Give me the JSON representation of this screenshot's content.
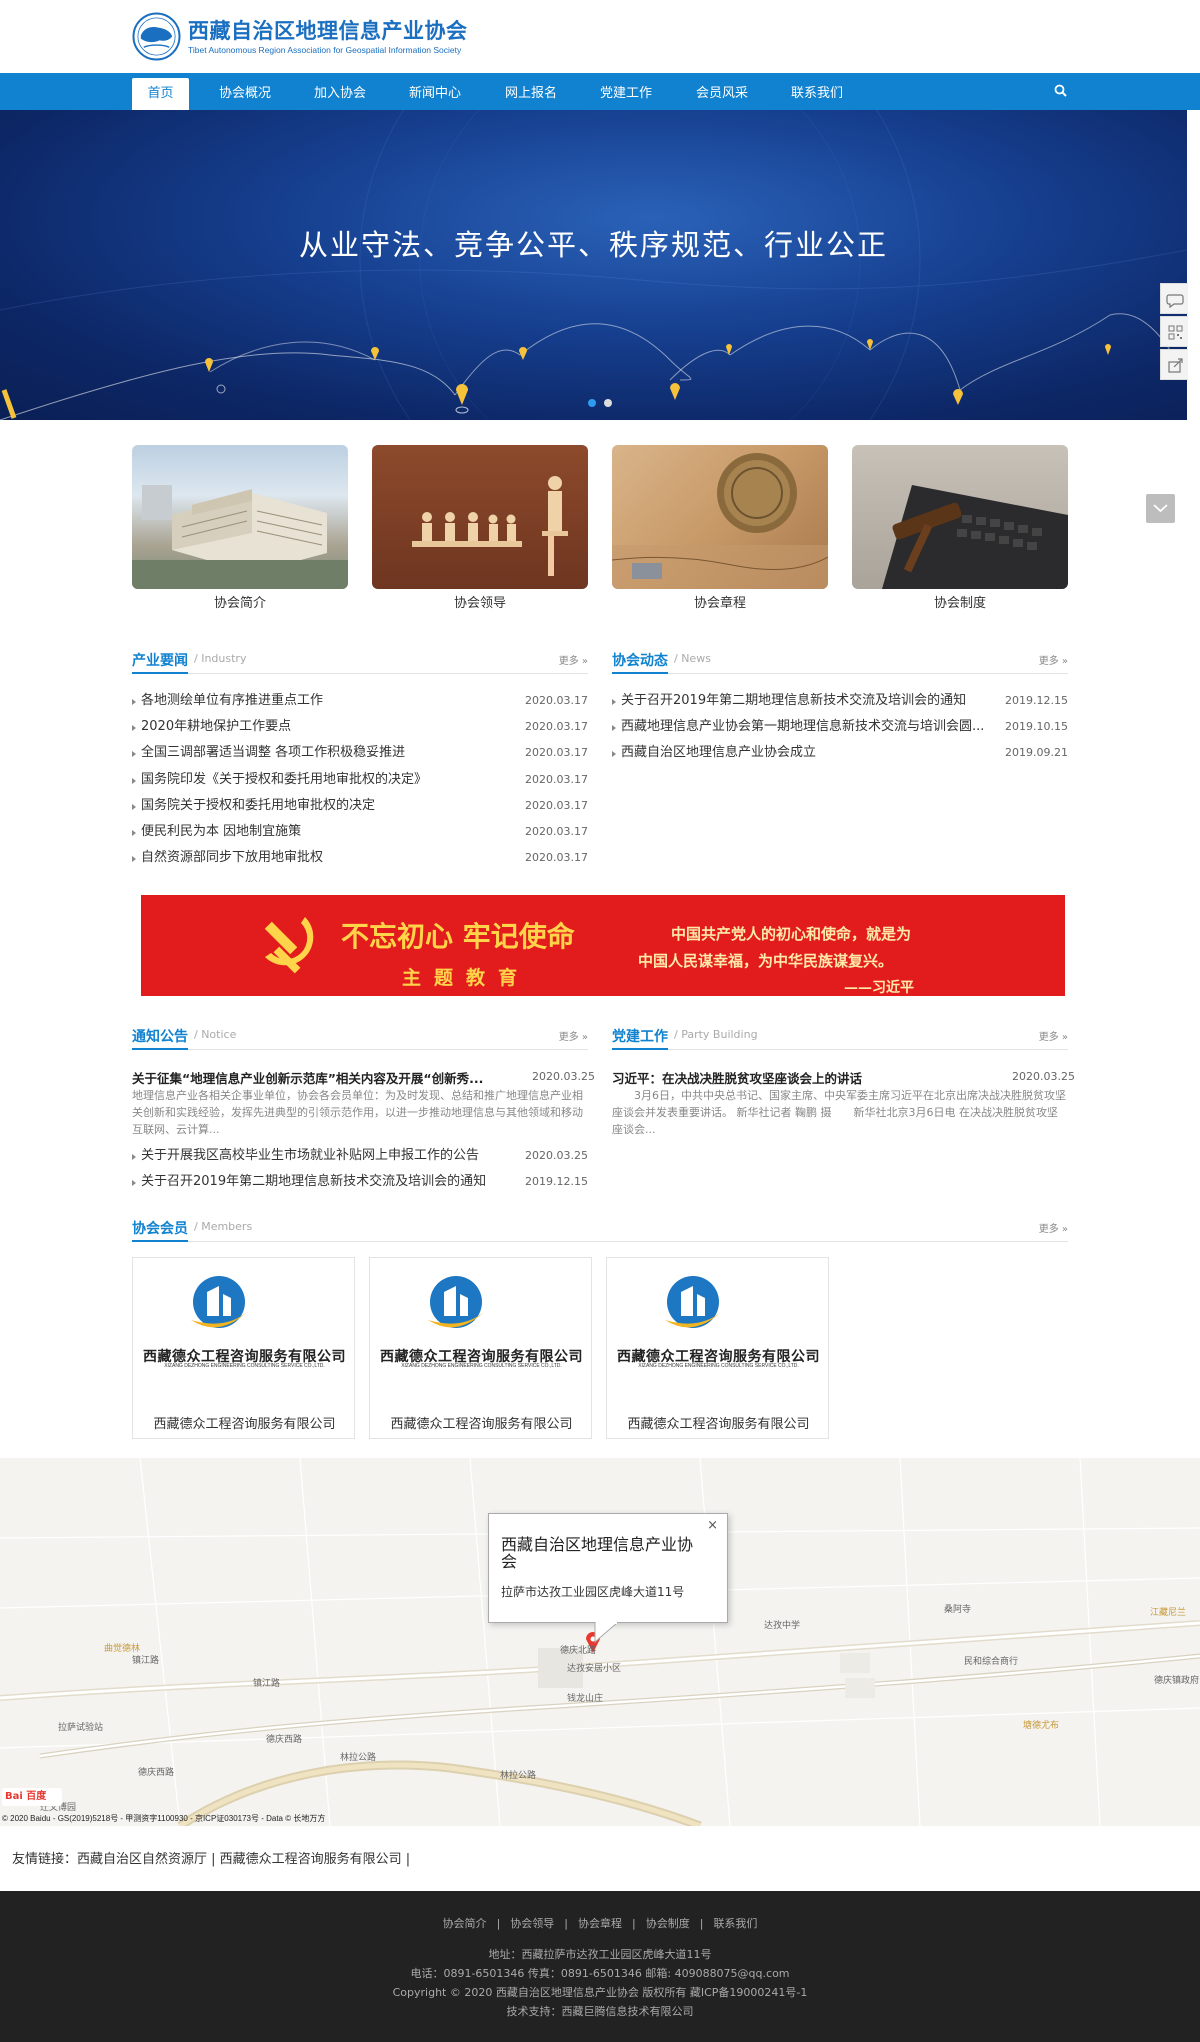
{
  "header": {
    "title": "西藏自治区地理信息产业协会",
    "subtitle": "Tibet Autonomous Region Association for Geospatial Information Society"
  },
  "nav": {
    "items": [
      "首页",
      "协会概况",
      "加入协会",
      "新闻中心",
      "网上报名",
      "党建工作",
      "会员风采",
      "联系我们"
    ],
    "active": "首页",
    "search_icon": "search-icon"
  },
  "banner": {
    "slogan": "从业守法、竞争公平、秩序规范、行业公正",
    "slides_total": 2,
    "active_slide": 1
  },
  "side_tools": [
    "chat-icon",
    "qrcode-icon",
    "share-icon"
  ],
  "features": [
    {
      "label": "协会简介"
    },
    {
      "label": "协会领导"
    },
    {
      "label": "协会章程"
    },
    {
      "label": "协会制度"
    }
  ],
  "industry": {
    "title": "产业要闻",
    "subtitle": "/ Industry",
    "more": "更多 »",
    "items": [
      {
        "title": "各地测绘单位有序推进重点工作",
        "date": "2020.03.17"
      },
      {
        "title": "2020年耕地保护工作要点",
        "date": "2020.03.17"
      },
      {
        "title": "全国三调部署适当调整 各项工作积极稳妥推进",
        "date": "2020.03.17"
      },
      {
        "title": "国务院印发《关于授权和委托用地审批权的决定》",
        "date": "2020.03.17"
      },
      {
        "title": "国务院关于授权和委托用地审批权的决定",
        "date": "2020.03.17"
      },
      {
        "title": "便民利民为本 因地制宜施策",
        "date": "2020.03.17"
      },
      {
        "title": "自然资源部同步下放用地审批权",
        "date": "2020.03.17"
      }
    ]
  },
  "dynamics": {
    "title": "协会动态",
    "subtitle": "/ News",
    "more": "更多 »",
    "items": [
      {
        "title": "关于召开2019年第二期地理信息新技术交流及培训会的通知",
        "date": "2019.12.15"
      },
      {
        "title": "西藏地理信息产业协会第一期地理信息新技术交流与培训会圆...",
        "date": "2019.10.15"
      },
      {
        "title": "西藏自治区地理信息产业协会成立",
        "date": "2019.09.21"
      }
    ]
  },
  "party_banner": {
    "slogan_main": "不忘初心 牢记使命",
    "slogan_sub": "主题教育",
    "quote_line1": "中国共产党人的初心和使命，就是为",
    "quote_line2": "中国人民谋幸福，为中华民族谋复兴。",
    "quote_author": "——习近平"
  },
  "notice": {
    "title": "通知公告",
    "subtitle": "/ Notice",
    "more": "更多 »",
    "lead": {
      "title": "关于征集“地理信息产业创新示范库”相关内容及开展“创新秀...",
      "date": "2020.03.25",
      "body": "地理信息产业各相关企事业单位，协会各会员单位：为及时发现、总结和推广地理信息产业相关创新和实践经验，发挥先进典型的引领示范作用，以进一步推动地理信息与其他领域和移动互联网、云计算..."
    },
    "items": [
      {
        "title": "关于开展我区高校毕业生市场就业补贴网上申报工作的公告",
        "date": "2020.03.25"
      },
      {
        "title": "关于召开2019年第二期地理信息新技术交流及培训会的通知",
        "date": "2019.12.15"
      }
    ]
  },
  "party": {
    "title": "党建工作",
    "subtitle": "/ Party Building",
    "more": "更多 »",
    "lead": {
      "title": "习近平：在决战决胜脱贫攻坚座谈会上的讲话",
      "date": "2020.03.25",
      "body": "　　3月6日，中共中央总书记、国家主席、中央军委主席习近平在北京出席决战决胜脱贫攻坚座谈会并发表重要讲话。 新华社记者 鞠鹏 摄　　新华社北京3月6日电 在决战决胜脱贫攻坚座谈会..."
    }
  },
  "members": {
    "title": "协会会员",
    "subtitle": "/ Members",
    "more": "更多 »",
    "items": [
      {
        "logo_cn": "西藏德众工程咨询服务有限公司",
        "logo_en": "XIZANG DEZHONG ENGINEERING CONSULTING SERVICE CO.,LTD.",
        "name": "西藏德众工程咨询服务有限公司"
      },
      {
        "logo_cn": "西藏德众工程咨询服务有限公司",
        "logo_en": "XIZANG DEZHONG ENGINEERING CONSULTING SERVICE CO.,LTD.",
        "name": "西藏德众工程咨询服务有限公司"
      },
      {
        "logo_cn": "西藏德众工程咨询服务有限公司",
        "logo_en": "XIZANG DEZHONG ENGINEERING CONSULTING SERVICE CO.,LTD.",
        "name": "西藏德众工程咨询服务有限公司"
      }
    ]
  },
  "map": {
    "popup_title": "西藏自治区地理信息产业协会",
    "popup_address": "拉萨市达孜工业园区虎峰大道11号",
    "popup_close": "×",
    "logo_text": "Bai 百度",
    "copyright": "© 2020 Baidu - GS(2019)5218号 - 甲测资字1100930 - 京ICP证030173号 - Data © 长地万方",
    "labels": [
      "镇江路",
      "镇江路",
      "拉萨试验站",
      "德庆西路",
      "德庆西路",
      "林拉公路",
      "林拉公路",
      "达孜安居小区",
      "钱龙山庄",
      "达孜中学",
      "桑阿寺",
      "民和综合商行",
      "德庆镇政府",
      "江藏尼兰",
      "塘德尤布",
      "德庆北路",
      "曲觉德林",
      "迁文博园"
    ]
  },
  "links": {
    "line": "友情链接：西藏自治区自然资源厅 | 西藏德众工程咨询服务有限公司 |"
  },
  "footer": {
    "nav": [
      "协会简介",
      "协会领导",
      "协会章程",
      "协会制度",
      "联系我们"
    ],
    "separator": "|",
    "address": "地址：西藏拉萨市达孜工业园区虎峰大道11号",
    "contact": "电话：0891-6501346 传真：0891-6501346 邮箱: 409088075@qq.com",
    "copyright": "Copyright © 2020 西藏自治区地理信息产业协会 版权所有 藏ICP备19000241号-1",
    "support": "技术支持：西藏巨腾信息技术有限公司"
  },
  "colors": {
    "brand_blue": "#1182d0",
    "party_red": "#e21c1c",
    "footer_bg": "#222222"
  }
}
